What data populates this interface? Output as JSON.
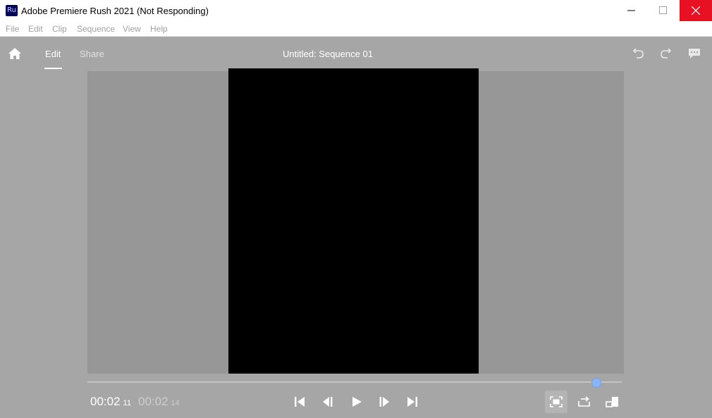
{
  "window": {
    "app_icon_text": "Ru",
    "title": "Adobe Premiere Rush 2021 (Not Responding)"
  },
  "menu": [
    "File",
    "Edit",
    "Clip",
    "Sequence",
    "View",
    "Help"
  ],
  "header": {
    "tabs": [
      {
        "label": "Edit",
        "active": true
      },
      {
        "label": "Share",
        "active": false
      }
    ],
    "document_title": "Untitled: Sequence 01"
  },
  "playback": {
    "current_time": "00:02",
    "current_frames": "11",
    "duration_time": "00:02",
    "duration_frames": "14",
    "playhead_position_fraction": 0.95
  },
  "icons": {
    "home": "home-icon",
    "undo": "undo-icon",
    "redo": "redo-icon",
    "comments": "comment-icon",
    "go_to_start": "skip-start-icon",
    "step_back": "step-back-icon",
    "play": "play-icon",
    "step_forward": "step-forward-icon",
    "go_to_end": "skip-end-icon",
    "fit": "fit-to-screen-icon",
    "loop": "loop-icon",
    "resize": "resize-icon"
  },
  "colors": {
    "app_background": "#a6a6a6",
    "close_button": "#e81123",
    "playhead": "#8ab4f8",
    "app_icon_bg": "#00005b"
  }
}
